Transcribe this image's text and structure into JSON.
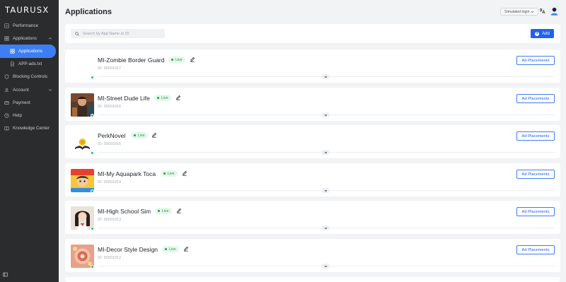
{
  "sidebar": {
    "logo": "TAURUSX",
    "items": [
      {
        "label": "Performance",
        "icon": "dashboard-icon"
      },
      {
        "label": "Applications",
        "icon": "apps-icon",
        "expanded": true
      },
      {
        "label": "Applications",
        "icon": "apps-icon",
        "active": true
      },
      {
        "label": "APP-ads.txt",
        "icon": "document-icon"
      },
      {
        "label": "Blocking Controls",
        "icon": "block-icon"
      },
      {
        "label": "Account",
        "icon": "account-icon",
        "expandable": true
      },
      {
        "label": "Payment",
        "icon": "payment-icon"
      },
      {
        "label": "Help",
        "icon": "help-icon"
      },
      {
        "label": "Knowledge Center",
        "icon": "knowledge-icon"
      }
    ]
  },
  "header": {
    "title": "Applications",
    "simulated_login": "Simulated login"
  },
  "search": {
    "placeholder": "Search by App Name or ID",
    "value": ""
  },
  "toolbar": {
    "add_label": "Add"
  },
  "apps": [
    {
      "name": "MI-Zombie Border Guard",
      "id": "ID: 30001017",
      "status": "Live",
      "placements_label": "Ad Placements"
    },
    {
      "name": "MI-Street Dude Life",
      "id": "ID: 30001016",
      "status": "Live",
      "placements_label": "Ad Placements"
    },
    {
      "name": "PerkNovel",
      "id": "ID: 30001015",
      "status": "Live",
      "placements_label": "Ad Placements"
    },
    {
      "name": "MI-My Aquapark Toca",
      "id": "ID: 30001014",
      "status": "Live",
      "placements_label": "Ad Placements"
    },
    {
      "name": "MI-High School Sim",
      "id": "ID: 30001013",
      "status": "Live",
      "placements_label": "Ad Placements"
    },
    {
      "name": "MI-Decor Style Design",
      "id": "ID: 30001012",
      "status": "Live",
      "placements_label": "Ad Placements"
    }
  ],
  "colors": {
    "sidebar_bg": "#2b2c2e",
    "accent": "#1e63f0",
    "live_green": "#1b9e4b",
    "page_bg": "#f2f3f5"
  }
}
